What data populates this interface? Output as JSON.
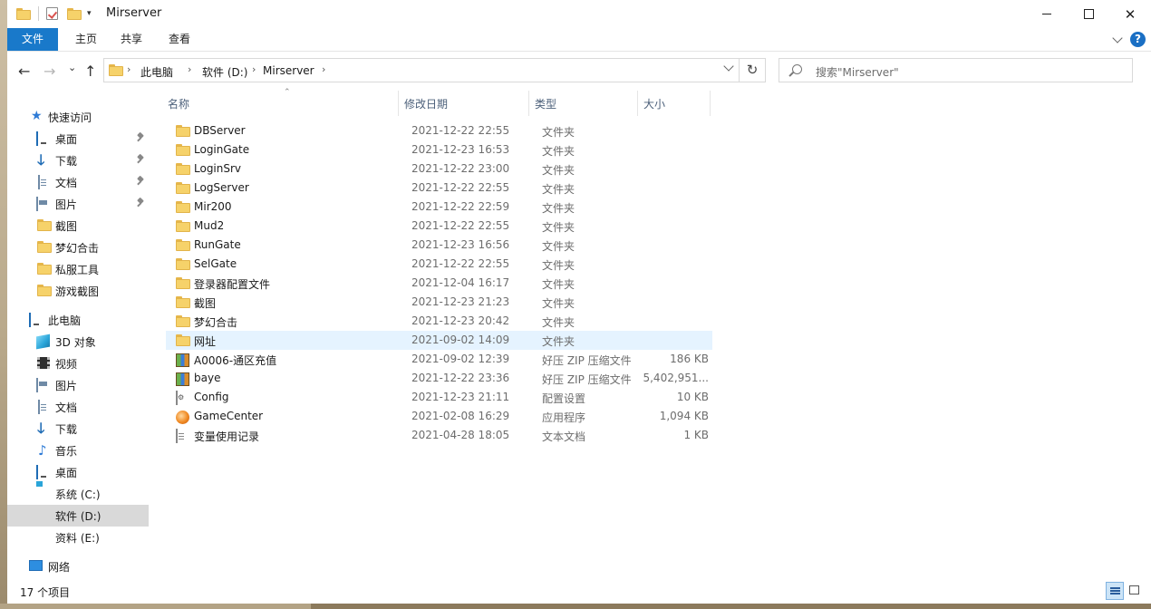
{
  "window": {
    "title": "Mirserver",
    "buttons": {
      "minimize": "—",
      "maximize": "☐",
      "close": "✕"
    }
  },
  "ribbon": {
    "tabs": [
      {
        "label": "文件",
        "active": true
      },
      {
        "label": "主页"
      },
      {
        "label": "共享"
      },
      {
        "label": "查看"
      }
    ],
    "help": "?"
  },
  "nav": {
    "back": "←",
    "forward": "→",
    "recent": "⌄",
    "up": "↑",
    "breadcrumb": [
      "此电脑",
      "软件 (D:)",
      "Mirserver"
    ],
    "refresh": "↻",
    "search_placeholder": "搜索\"Mirserver\""
  },
  "sidebar": {
    "quick_access": {
      "label": "快速访问",
      "icon": "star-icon"
    },
    "quick_items": [
      {
        "label": "桌面",
        "icon": "desktop-icon",
        "pinned": true
      },
      {
        "label": "下载",
        "icon": "download-icon",
        "pinned": true
      },
      {
        "label": "文档",
        "icon": "document-icon",
        "pinned": true
      },
      {
        "label": "图片",
        "icon": "picture-icon",
        "pinned": true
      },
      {
        "label": "截图",
        "icon": "folder-icon",
        "pinned": false
      },
      {
        "label": "梦幻合击",
        "icon": "folder-icon",
        "pinned": false
      },
      {
        "label": "私服工具",
        "icon": "folder-icon",
        "pinned": false
      },
      {
        "label": "游戏截图",
        "icon": "folder-icon",
        "pinned": false
      }
    ],
    "this_pc": {
      "label": "此电脑",
      "icon": "computer-icon"
    },
    "pc_items": [
      {
        "label": "3D 对象",
        "icon": "3d-objects-icon"
      },
      {
        "label": "视频",
        "icon": "video-icon"
      },
      {
        "label": "图片",
        "icon": "picture-icon"
      },
      {
        "label": "文档",
        "icon": "document-icon"
      },
      {
        "label": "下载",
        "icon": "download-icon"
      },
      {
        "label": "音乐",
        "icon": "music-icon"
      },
      {
        "label": "桌面",
        "icon": "desktop-icon"
      },
      {
        "label": "系统 (C:)",
        "icon": "system-drive-icon"
      },
      {
        "label": "软件 (D:)",
        "icon": "drive-icon",
        "selected": true
      },
      {
        "label": "资料 (E:)",
        "icon": "drive-icon"
      }
    ],
    "network": {
      "label": "网络",
      "icon": "network-icon"
    }
  },
  "columns": {
    "name": "名称",
    "date": "修改日期",
    "type": "类型",
    "size": "大小"
  },
  "files": [
    {
      "name": "DBServer",
      "date": "2021-12-22 22:55",
      "type": "文件夹",
      "size": "",
      "icon": "folder-icon"
    },
    {
      "name": "LoginGate",
      "date": "2021-12-23 16:53",
      "type": "文件夹",
      "size": "",
      "icon": "folder-icon"
    },
    {
      "name": "LoginSrv",
      "date": "2021-12-22 23:00",
      "type": "文件夹",
      "size": "",
      "icon": "folder-icon"
    },
    {
      "name": "LogServer",
      "date": "2021-12-22 22:55",
      "type": "文件夹",
      "size": "",
      "icon": "folder-icon"
    },
    {
      "name": "Mir200",
      "date": "2021-12-22 22:59",
      "type": "文件夹",
      "size": "",
      "icon": "folder-icon"
    },
    {
      "name": "Mud2",
      "date": "2021-12-22 22:55",
      "type": "文件夹",
      "size": "",
      "icon": "folder-icon"
    },
    {
      "name": "RunGate",
      "date": "2021-12-23 16:56",
      "type": "文件夹",
      "size": "",
      "icon": "folder-icon"
    },
    {
      "name": "SelGate",
      "date": "2021-12-22 22:55",
      "type": "文件夹",
      "size": "",
      "icon": "folder-icon"
    },
    {
      "name": "登录器配置文件",
      "date": "2021-12-04 16:17",
      "type": "文件夹",
      "size": "",
      "icon": "folder-icon"
    },
    {
      "name": "截图",
      "date": "2021-12-23 21:23",
      "type": "文件夹",
      "size": "",
      "icon": "folder-icon"
    },
    {
      "name": "梦幻合击",
      "date": "2021-12-23 20:42",
      "type": "文件夹",
      "size": "",
      "icon": "folder-icon"
    },
    {
      "name": "网址",
      "date": "2021-09-02 14:09",
      "type": "文件夹",
      "size": "",
      "icon": "folder-icon",
      "hover": true
    },
    {
      "name": "A0006-通区充值",
      "date": "2021-09-02 12:39",
      "type": "好压 ZIP 压缩文件",
      "size": "186 KB",
      "icon": "zip-icon"
    },
    {
      "name": "baye",
      "date": "2021-12-22 23:36",
      "type": "好压 ZIP 压缩文件",
      "size": "5,402,951...",
      "icon": "zip-icon"
    },
    {
      "name": "Config",
      "date": "2021-12-23 21:11",
      "type": "配置设置",
      "size": "10 KB",
      "icon": "config-icon"
    },
    {
      "name": "GameCenter",
      "date": "2021-02-08 16:29",
      "type": "应用程序",
      "size": "1,094 KB",
      "icon": "app-icon"
    },
    {
      "name": "变量使用记录",
      "date": "2021-04-28 18:05",
      "type": "文本文档",
      "size": "1 KB",
      "icon": "text-file-icon"
    }
  ],
  "status": {
    "item_count": "17 个项目"
  },
  "colors": {
    "accent": "#1979ca",
    "hover_row": "#e5f3ff",
    "selected_nav": "#d9d9d9",
    "folder": "#f6d26a"
  }
}
